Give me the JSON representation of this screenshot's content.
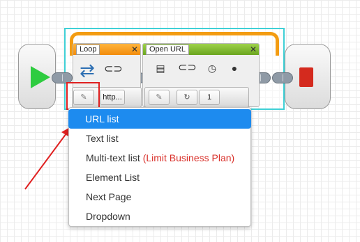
{
  "loop_block": {
    "title": "Loop",
    "param_value": "http..."
  },
  "open_url_block": {
    "title": "Open URL",
    "param_value": "1"
  },
  "menu": {
    "items": [
      {
        "label": "URL list",
        "note": ""
      },
      {
        "label": "Text list",
        "note": ""
      },
      {
        "label": "Multi-text list",
        "note": "(Limit Business Plan)"
      },
      {
        "label": "Element List",
        "note": ""
      },
      {
        "label": "Next Page",
        "note": ""
      },
      {
        "label": "Dropdown",
        "note": ""
      }
    ],
    "selected_index": 0
  },
  "colors": {
    "loop_frame": "#3fd0d6",
    "loop_arc": "#f39c12",
    "loop_header": "#f28c0c",
    "open_url_header": "#6aa51f",
    "start": "#2ecc40",
    "stop": "#d42a1e",
    "highlight": "#e02020",
    "menu_selected": "#1d8bef",
    "note": "#d9302a"
  },
  "icons": [
    "play-icon",
    "stop-icon",
    "loop-icon",
    "link-icon",
    "open-page-icon",
    "clock-icon",
    "cookie-icon",
    "pencil-icon",
    "refresh-icon"
  ]
}
